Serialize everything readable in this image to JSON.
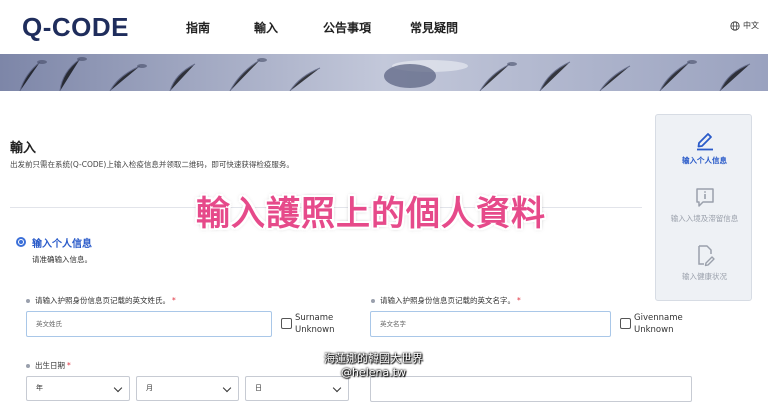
{
  "header": {
    "logo": "Q-CODE",
    "nav": [
      "指南",
      "輸入",
      "公告事項",
      "常見疑問"
    ],
    "lang": "中文"
  },
  "page": {
    "title": "輸入",
    "description": "出发前只需在系统(Q-CODE)上输入检疫信息并领取二维码，即可快速获得检疫服务。"
  },
  "overlay_caption": "輸入護照上的個人資料",
  "section": {
    "title": "输入个人信息",
    "subtitle": "请准确输入信息。"
  },
  "fields": {
    "surname": {
      "label": "请输入护照身份信息页记载的英文姓氏。",
      "placeholder": "英文姓氏",
      "checkbox": "Surname Unknown"
    },
    "givenname": {
      "label": "请输入护照身份信息页记载的英文名字。",
      "placeholder": "英文名字",
      "checkbox": "Givenname Unknown"
    },
    "birthdate": {
      "label": "出生日期",
      "year": "年",
      "month": "月",
      "day": "日"
    },
    "required_mark": "*"
  },
  "steps": [
    {
      "label": "输入个人信息",
      "state": "active",
      "icon": "pencil-icon"
    },
    {
      "label": "输入入境及滞留信息",
      "state": "inactive",
      "icon": "info-icon"
    },
    {
      "label": "输入健康状况",
      "state": "inactive",
      "icon": "document-edit-icon"
    }
  ],
  "watermark": {
    "line1": "海蓮娜的韓國大世界",
    "line2": "@helena.tw"
  },
  "colors": {
    "brand": "#1f2d5c",
    "accent_blue": "#2a5bc9",
    "required_red": "#e0323f",
    "caption_pink": "#e64a8a"
  }
}
